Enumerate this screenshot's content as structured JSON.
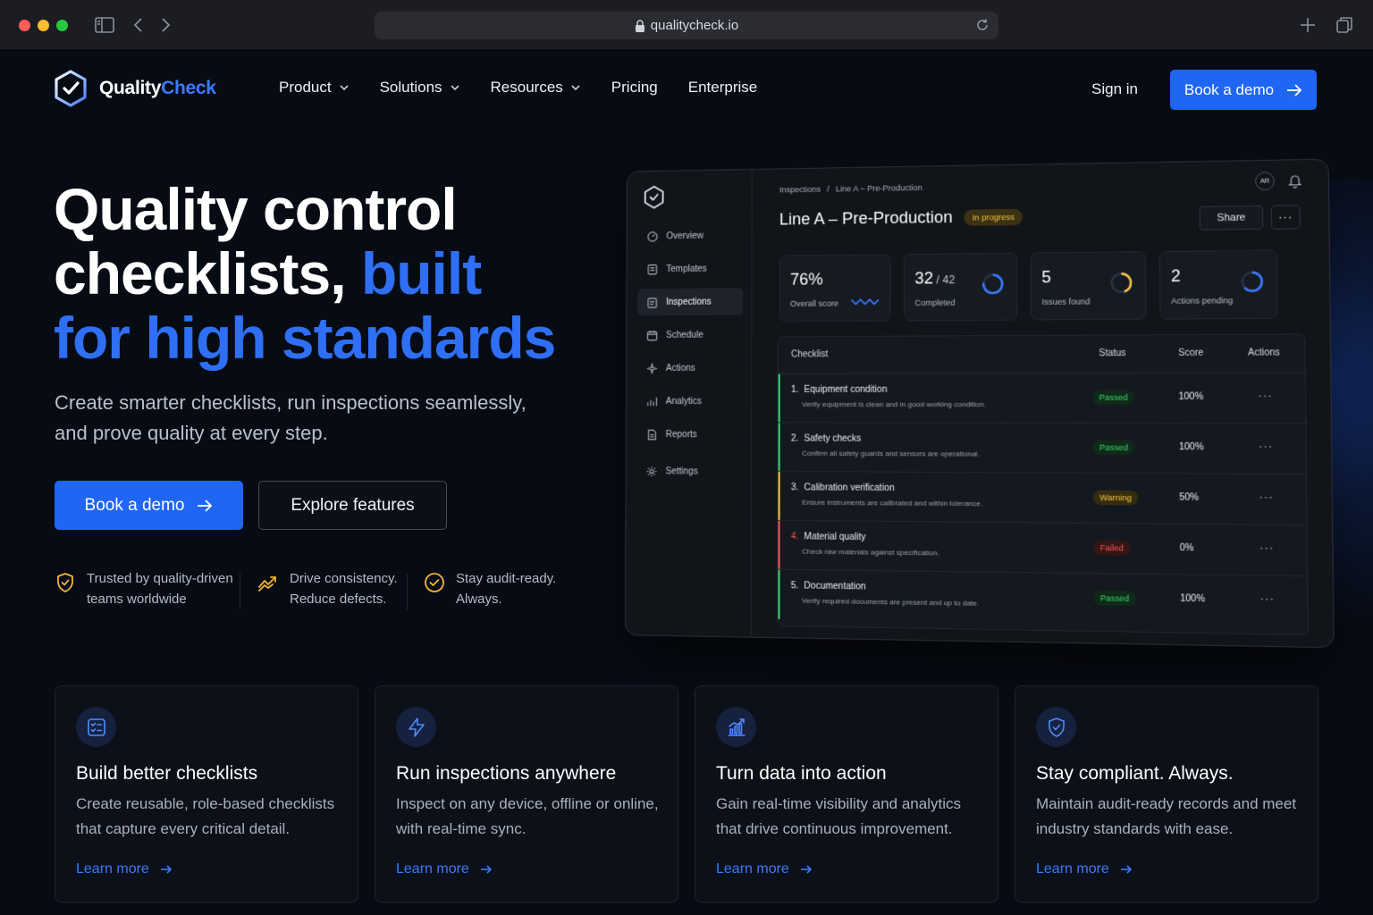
{
  "browser": {
    "url": "qualitycheck.io"
  },
  "brand": {
    "name_part1": "Quality",
    "name_part2": "Check",
    "accent": "#3d7bff"
  },
  "nav": {
    "items": [
      {
        "label": "Product",
        "dropdown": true
      },
      {
        "label": "Solutions",
        "dropdown": true
      },
      {
        "label": "Resources",
        "dropdown": true
      },
      {
        "label": "Pricing",
        "dropdown": false
      },
      {
        "label": "Enterprise",
        "dropdown": false
      }
    ],
    "signin": "Sign in",
    "demo": "Book a demo"
  },
  "hero": {
    "title_line1": "Quality control",
    "title_line2a": "checklists, ",
    "title_line2b": "built",
    "title_line3": "for high standards",
    "subtitle": "Create smarter checklists, run inspections seamlessly, and prove quality at every step.",
    "primary_cta": "Book a demo",
    "secondary_cta": "Explore features",
    "trust": [
      {
        "icon": "shield-check-icon",
        "line1": "Trusted by quality-driven",
        "line2": "teams worldwide"
      },
      {
        "icon": "trend-chart-icon",
        "line1": "Drive consistency.",
        "line2": "Reduce defects."
      },
      {
        "icon": "check-circle-icon",
        "line1": "Stay audit-ready.",
        "line2": "Always."
      }
    ]
  },
  "dashboard": {
    "sidebar": [
      "Overview",
      "Templates",
      "Inspections",
      "Schedule",
      "Actions",
      "Analytics",
      "Reports",
      "Settings"
    ],
    "active_item": "Inspections",
    "breadcrumb": [
      "Inspections",
      "Line A – Pre-Production"
    ],
    "title": "Line A – Pre-Production",
    "status": "In progress",
    "avatar": "AR",
    "share": "Share",
    "more": "···",
    "stats": [
      {
        "value": "76%",
        "suffix": "",
        "label": "Overall score"
      },
      {
        "value": "32",
        "suffix": " / 42",
        "label": "Completed"
      },
      {
        "value": "5",
        "suffix": "",
        "label": "Issues found"
      },
      {
        "value": "2",
        "suffix": "",
        "label": "Actions pending"
      }
    ],
    "table": {
      "headers": [
        "Checklist",
        "Status",
        "Score",
        "Actions"
      ],
      "rows": [
        {
          "num": "1.",
          "name": "Equipment condition",
          "desc": "Verify equipment is clean and in good working condition.",
          "status": "Passed",
          "score": "100%",
          "color": "#39d66b"
        },
        {
          "num": "2.",
          "name": "Safety checks",
          "desc": "Confirm all safety guards and sensors are operational.",
          "status": "Passed",
          "score": "100%",
          "color": "#39d66b"
        },
        {
          "num": "3.",
          "name": "Calibration verification",
          "desc": "Ensure instruments are calibrated and within tolerance.",
          "status": "Warning",
          "score": "50%",
          "color": "#f5c542"
        },
        {
          "num": "4.",
          "name": "Material quality",
          "desc": "Check raw materials against specification.",
          "status": "Failed",
          "score": "0%",
          "color": "#f25555"
        },
        {
          "num": "5.",
          "name": "Documentation",
          "desc": "Verify required documents are present and up to date.",
          "status": "Passed",
          "score": "100%",
          "color": "#39d66b"
        }
      ],
      "row_action": "···"
    }
  },
  "features": [
    {
      "icon": "checklist-icon",
      "title": "Build better checklists",
      "text": "Create reusable, role-based checklists that capture every critical detail.",
      "link": "Learn more"
    },
    {
      "icon": "lightning-icon",
      "title": "Run inspections anywhere",
      "text": "Inspect on any device, offline or online, with real-time sync.",
      "link": "Learn more"
    },
    {
      "icon": "analytics-icon",
      "title": "Turn data into action",
      "text": "Gain real-time visibility and analytics that drive continuous improvement.",
      "link": "Learn more"
    },
    {
      "icon": "shield-check-icon",
      "title": "Stay compliant. Always.",
      "text": "Maintain audit-ready records and meet industry standards with ease.",
      "link": "Learn more"
    }
  ]
}
